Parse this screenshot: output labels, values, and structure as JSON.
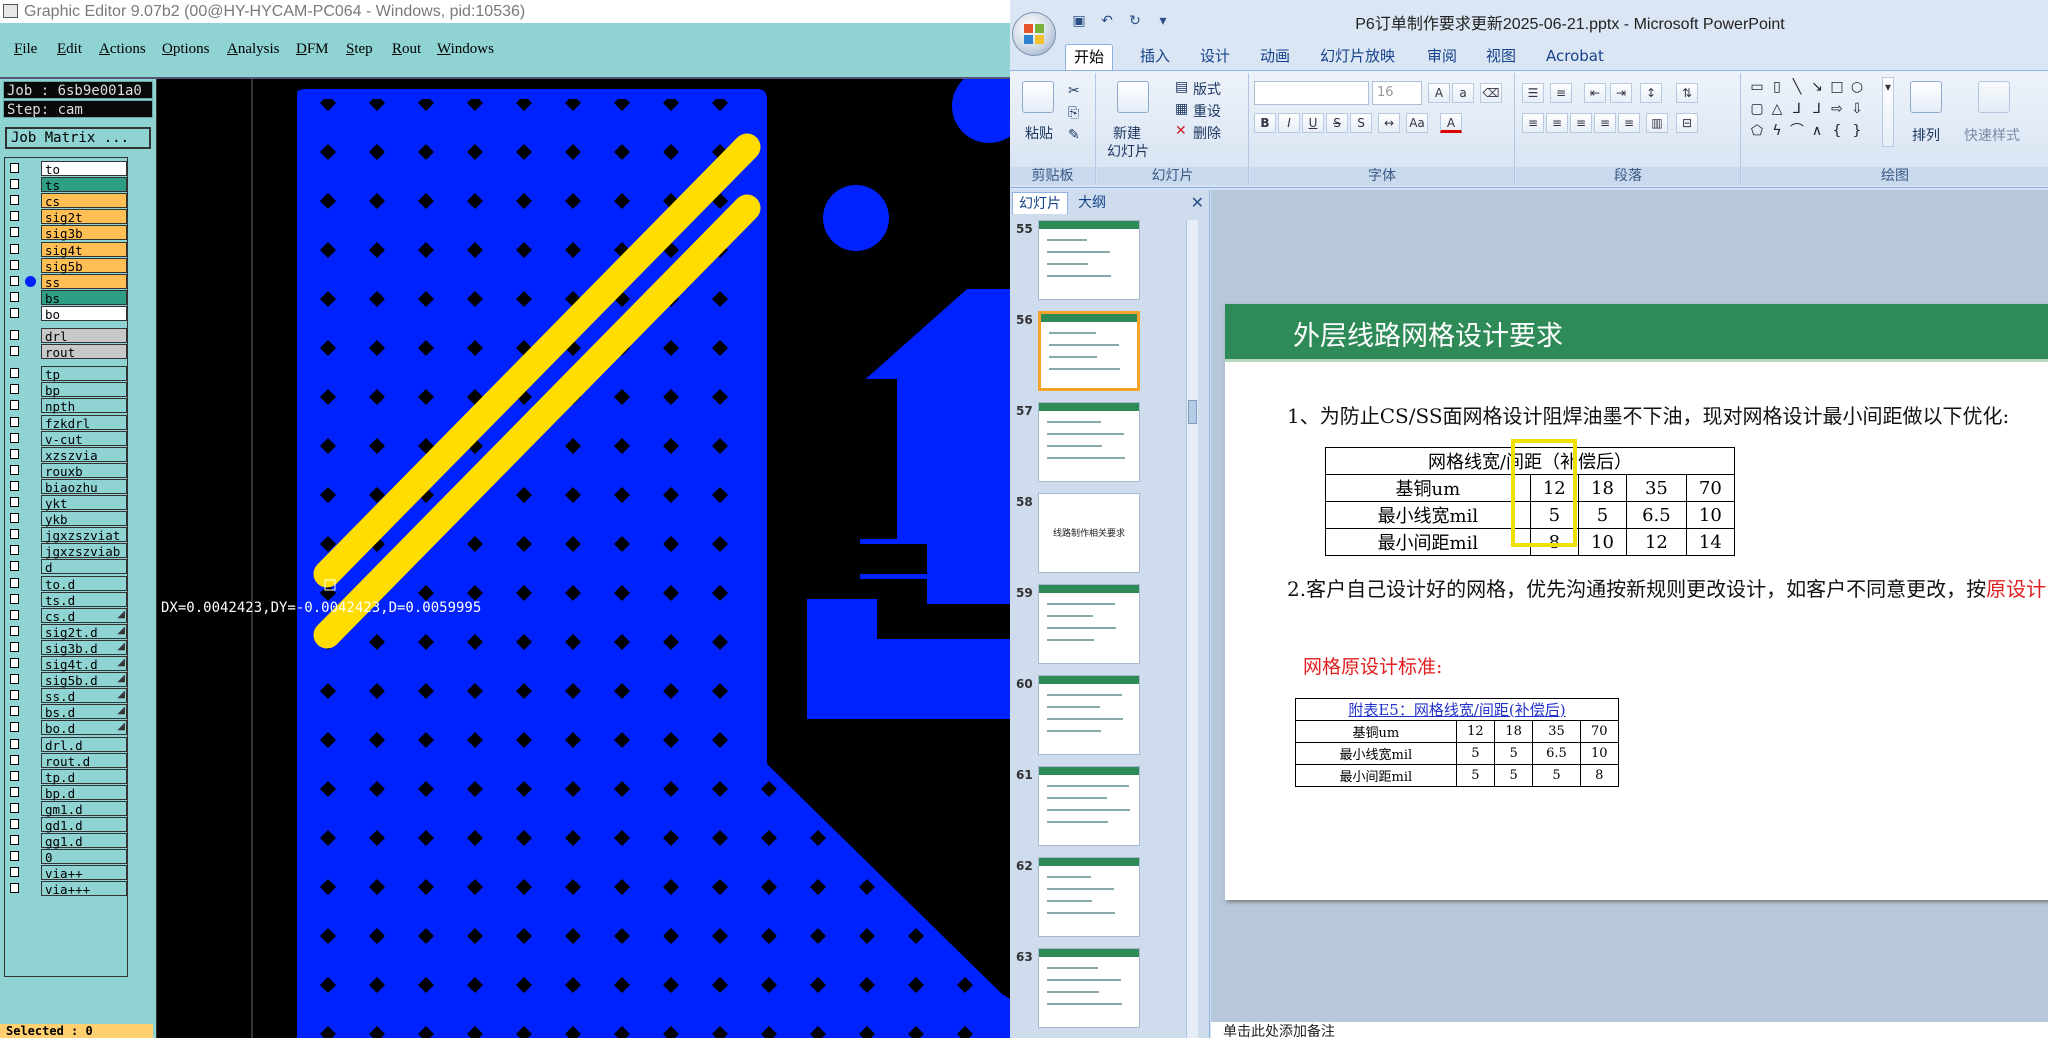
{
  "graphic_editor": {
    "window_title": "Graphic Editor 9.07b2 (00@HY-HYCAM-PC064 - Windows, pid:10536)",
    "menu": [
      "File",
      "Edit",
      "Actions",
      "Options",
      "Analysis",
      "DFM",
      "Step",
      "Rout",
      "Windows"
    ],
    "job_label": "Job : 6sb9e001a0",
    "step_label": "Step: cam",
    "job_matrix_button": "Job Matrix ...",
    "layers": [
      {
        "name": "to",
        "color": "#ffffff"
      },
      {
        "name": "ts",
        "color": "#2e9e85"
      },
      {
        "name": "cs",
        "color": "#ffbf55"
      },
      {
        "name": "sig2t",
        "color": "#ffbf55"
      },
      {
        "name": "sig3b",
        "color": "#ffbf55"
      },
      {
        "name": "sig4t",
        "color": "#ffbf55"
      },
      {
        "name": "sig5b",
        "color": "#ffbf55"
      },
      {
        "name": "ss",
        "color": "#ffbf55"
      },
      {
        "name": "bs",
        "color": "#2e9e85"
      },
      {
        "name": "bo",
        "color": "#ffffff"
      },
      {
        "name": "drl",
        "color": "#c8c8c8"
      },
      {
        "name": "rout",
        "color": "#c8c8c8"
      },
      {
        "name": "tp",
        "color": "#8fd3d3"
      },
      {
        "name": "bp",
        "color": "#8fd3d3"
      },
      {
        "name": "npth",
        "color": "#8fd3d3"
      },
      {
        "name": "fzkdrl",
        "color": "#8fd3d3"
      },
      {
        "name": "v-cut",
        "color": "#8fd3d3"
      },
      {
        "name": "xzszvia",
        "color": "#8fd3d3"
      },
      {
        "name": "rouxb",
        "color": "#8fd3d3"
      },
      {
        "name": "biaozhu",
        "color": "#8fd3d3"
      },
      {
        "name": "ykt",
        "color": "#8fd3d3"
      },
      {
        "name": "ykb",
        "color": "#8fd3d3"
      },
      {
        "name": "jgxzszviat",
        "color": "#8fd3d3"
      },
      {
        "name": "jgxzszviab",
        "color": "#8fd3d3"
      },
      {
        "name": "d",
        "color": "#8fd3d3"
      },
      {
        "name": "to.d",
        "color": "#8fd3d3"
      },
      {
        "name": "ts.d",
        "color": "#8fd3d3"
      },
      {
        "name": "cs.d",
        "color": "#8fd3d3"
      },
      {
        "name": "sig2t.d",
        "color": "#8fd3d3"
      },
      {
        "name": "sig3b.d",
        "color": "#8fd3d3"
      },
      {
        "name": "sig4t.d",
        "color": "#8fd3d3"
      },
      {
        "name": "sig5b.d",
        "color": "#8fd3d3"
      },
      {
        "name": "ss.d",
        "color": "#8fd3d3"
      },
      {
        "name": "bs.d",
        "color": "#8fd3d3"
      },
      {
        "name": "bo.d",
        "color": "#8fd3d3"
      },
      {
        "name": "drl.d",
        "color": "#8fd3d3"
      },
      {
        "name": "rout.d",
        "color": "#8fd3d3"
      },
      {
        "name": "tp.d",
        "color": "#8fd3d3"
      },
      {
        "name": "bp.d",
        "color": "#8fd3d3"
      },
      {
        "name": "gm1.d",
        "color": "#8fd3d3"
      },
      {
        "name": "gd1.d",
        "color": "#8fd3d3"
      },
      {
        "name": "gg1.d",
        "color": "#8fd3d3"
      },
      {
        "name": "0",
        "color": "#8fd3d3"
      },
      {
        "name": "via++",
        "color": "#8fd3d3"
      },
      {
        "name": "via+++",
        "color": "#8fd3d3"
      }
    ],
    "measure_readout": "DX=0.0042423,DY=-0.0042423,D=0.0059995",
    "status": "Selected : 0",
    "colors": {
      "copper": "#0022ff",
      "trace": "#ffdd00",
      "panel": "#8fd3d3"
    }
  },
  "powerpoint": {
    "window_title": "P6订单制作要求更新2025-06-21.pptx - Microsoft PowerPoint",
    "tabs": [
      "开始",
      "插入",
      "设计",
      "动画",
      "幻灯片放映",
      "审阅",
      "视图",
      "Acrobat"
    ],
    "ribbon": {
      "clipboard": {
        "paste": "粘贴",
        "label": "剪贴板"
      },
      "slides": {
        "new_slide_line1": "新建",
        "new_slide_line2": "幻灯片",
        "layout": "版式",
        "reset": "重设",
        "delete": "删除",
        "label": "幻灯片"
      },
      "font": {
        "size": "16",
        "label": "字体"
      },
      "paragraph": {
        "label": "段落"
      },
      "drawing": {
        "arrange": "排列",
        "quick_styles": "快速样式",
        "label": "绘图"
      }
    },
    "panel_tabs": [
      "幻灯片",
      "大纲"
    ],
    "thumbnails": [
      {
        "num": "55",
        "text": ""
      },
      {
        "num": "56",
        "text": ""
      },
      {
        "num": "57",
        "text": ""
      },
      {
        "num": "58",
        "text": "线路制作相关要求"
      },
      {
        "num": "59",
        "text": ""
      },
      {
        "num": "60",
        "text": ""
      },
      {
        "num": "61",
        "text": ""
      },
      {
        "num": "62",
        "text": ""
      },
      {
        "num": "63",
        "text": ""
      }
    ],
    "slide": {
      "title": "外层线路网格设计要求",
      "point1": "1、为防止CS/SS面网格设计阻焊油墨不下油，现对网格设计最小间距做以下优化:",
      "table1": {
        "header": "网格线宽/间距（补偿后）",
        "rows": [
          [
            "基铜um",
            "12",
            "18",
            "35",
            "70"
          ],
          [
            "最小线宽mil",
            "5",
            "5",
            "6.5",
            "10"
          ],
          [
            "最小间距mil",
            "8",
            "10",
            "12",
            "14"
          ]
        ]
      },
      "point2_black": "2.客户自己设计好的网格，优先沟通按新规则更改设计，如客户不同意更改，按",
      "point2_red": "原设计",
      "orig_label": "网格原设计标准:",
      "table2": {
        "caption": "附表E5：网格线宽/间距(补偿后)",
        "rows": [
          [
            "基铜um",
            "12",
            "18",
            "35",
            "70"
          ],
          [
            "最小线宽mil",
            "5",
            "5",
            "6.5",
            "10"
          ],
          [
            "最小间距mil",
            "5",
            "5",
            "5",
            "8"
          ]
        ]
      }
    },
    "notes_placeholder": "单击此处添加备注",
    "colors": {
      "slide_header": "#2e8b57",
      "highlight": "#f0e000",
      "red": "#e02020"
    }
  }
}
